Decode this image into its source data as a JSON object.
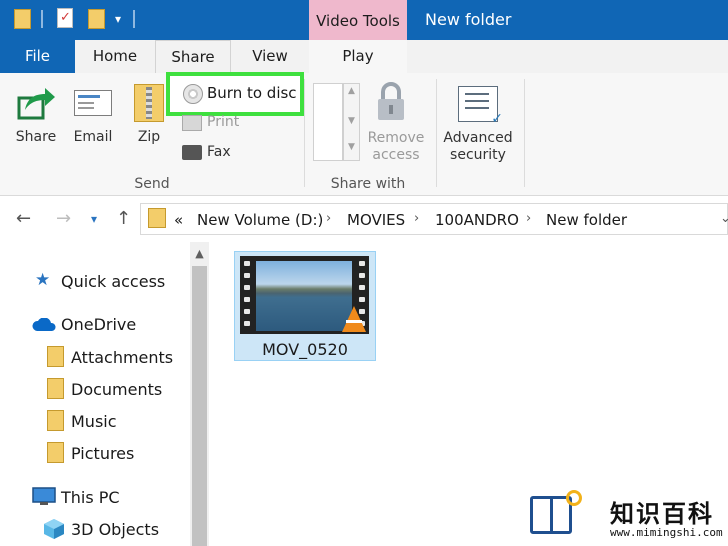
{
  "window": {
    "title": "New folder",
    "context_tab_title": "Video Tools"
  },
  "menu_tabs": {
    "file": "File",
    "home": "Home",
    "share": "Share",
    "view": "View",
    "play": "Play"
  },
  "ribbon": {
    "share_label": "Share",
    "email_label": "Email",
    "zip_label": "Zip",
    "burn_label": "Burn to disc",
    "print_label": "Print",
    "fax_label": "Fax",
    "send_group": "Send",
    "remove_access_line1": "Remove",
    "remove_access_line2": "access",
    "share_with_group": "Share with",
    "advanced_security_line1": "Advanced",
    "advanced_security_line2": "security"
  },
  "address": {
    "overflow": "«",
    "crumbs": [
      "New Volume (D:)",
      "MOVIES",
      "100ANDRO",
      "New folder"
    ]
  },
  "sidebar": {
    "quick_access": "Quick access",
    "onedrive": "OneDrive",
    "folders": [
      "Attachments",
      "Documents",
      "Music",
      "Pictures"
    ],
    "this_pc": "This PC",
    "objects_3d": "3D Objects"
  },
  "content": {
    "file_name": "MOV_0520"
  },
  "watermark": {
    "title": "知识百科",
    "url": "www.mimingshi.com"
  }
}
